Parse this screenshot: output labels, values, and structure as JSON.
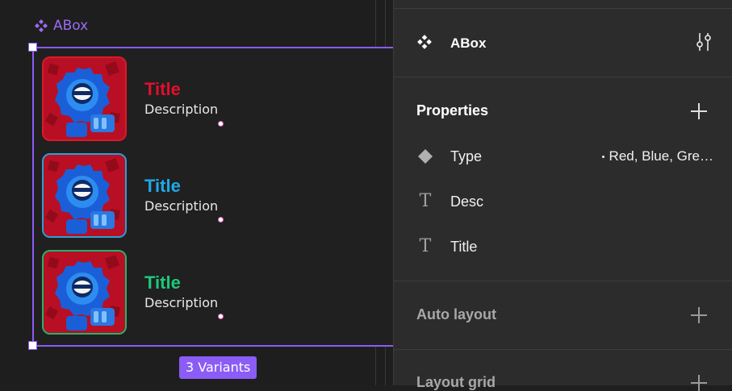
{
  "canvas": {
    "component_name": "ABox",
    "variants_badge": "3 Variants",
    "variants": [
      {
        "title": "Title",
        "description": "Description",
        "color": "#e0102c",
        "border": "#d91a2a"
      },
      {
        "title": "Title",
        "description": "Description",
        "color": "#1fa8e8",
        "border": "#2a9fd8"
      },
      {
        "title": "Title",
        "description": "Description",
        "color": "#1fc77a",
        "border": "#23b46a"
      }
    ],
    "selection_color": "#8b5cf6"
  },
  "panel": {
    "component_name": "ABox",
    "properties_heading": "Properties",
    "properties": [
      {
        "icon": "diamond-icon",
        "label": "Type",
        "value": "Red, Blue, Gre…"
      },
      {
        "icon": "text-icon",
        "label": "Desc"
      },
      {
        "icon": "text-icon",
        "label": "Title"
      }
    ],
    "auto_layout_heading": "Auto layout",
    "layout_grid_heading": "Layout grid"
  }
}
